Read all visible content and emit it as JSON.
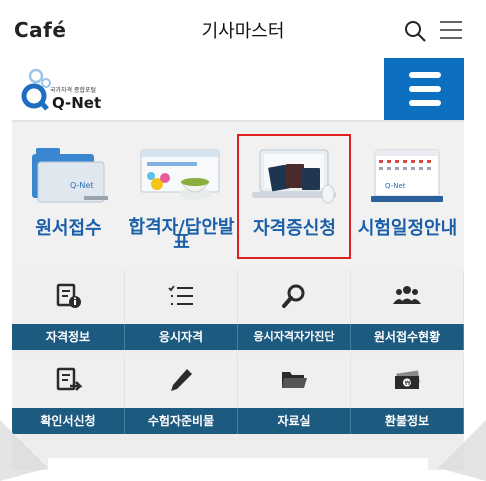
{
  "cafe": {
    "logo": "Café",
    "title": "기사마스터"
  },
  "qnet": {
    "logo_small_text": "국가자격 종합포털",
    "logo_text": "Q-Net",
    "colors": {
      "brand_blue": "#0c6fc0",
      "label_blue": "#1a5fa8",
      "bar_navy": "#1d5a80",
      "highlight_red": "#e02020"
    }
  },
  "main_services": [
    {
      "label": "원서접수",
      "icon": "folder-illustration"
    },
    {
      "label": "합격자/답안발표",
      "icon": "browser-teacup-illustration"
    },
    {
      "label": "자격증신청",
      "icon": "laptop-passport-illustration",
      "highlighted": true
    },
    {
      "label": "시험일정안내",
      "icon": "calendar-illustration"
    }
  ],
  "menu_row1": [
    {
      "label": "자격정보",
      "icon": "document-info-icon"
    },
    {
      "label": "응시자격",
      "icon": "checklist-icon"
    },
    {
      "label": "응시자격자가진단",
      "icon": "magnifier-icon"
    },
    {
      "label": "원서접수현황",
      "icon": "people-group-icon"
    }
  ],
  "menu_row2": [
    {
      "label": "확인서신청",
      "icon": "document-arrow-icon"
    },
    {
      "label": "수험자준비물",
      "icon": "pencil-icon"
    },
    {
      "label": "자료실",
      "icon": "folder-icon"
    },
    {
      "label": "환불정보",
      "icon": "money-icon"
    }
  ]
}
